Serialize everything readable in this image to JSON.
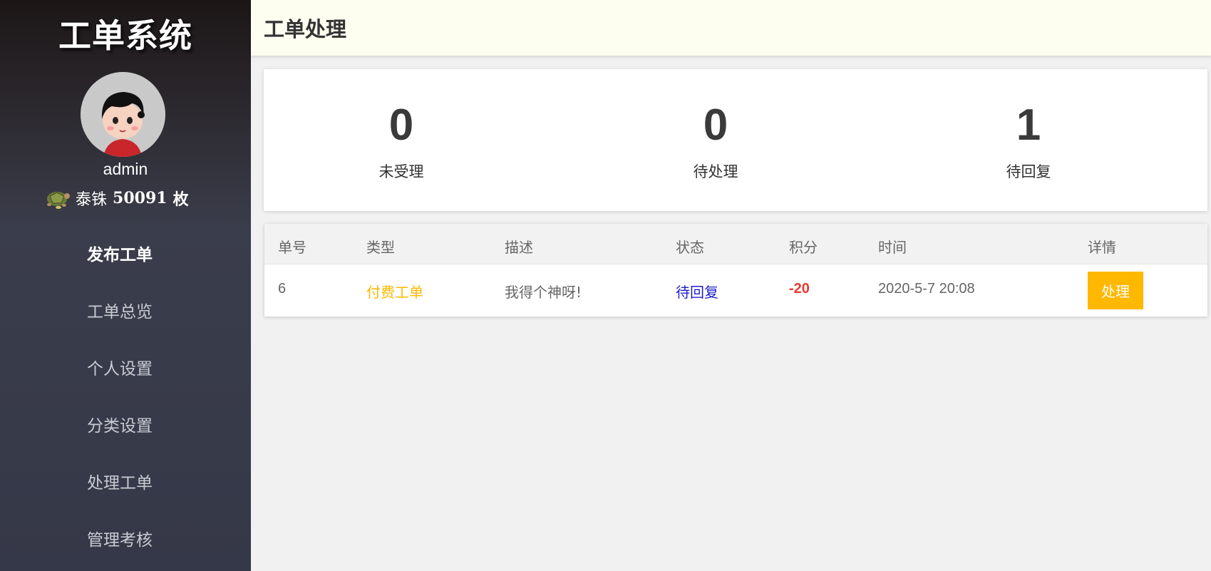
{
  "sidebar": {
    "brand": "工单系统",
    "username": "admin",
    "coins": {
      "label": "泰铢",
      "count": "50091",
      "unit": "枚"
    },
    "nav": [
      {
        "label": "发布工单",
        "active": true
      },
      {
        "label": "工单总览",
        "active": false
      },
      {
        "label": "个人设置",
        "active": false
      },
      {
        "label": "分类设置",
        "active": false
      },
      {
        "label": "处理工单",
        "active": false
      },
      {
        "label": "管理考核",
        "active": false
      }
    ]
  },
  "header": {
    "title": "工单处理"
  },
  "stats": [
    {
      "value": "0",
      "label": "未受理"
    },
    {
      "value": "0",
      "label": "待处理"
    },
    {
      "value": "1",
      "label": "待回复"
    }
  ],
  "table": {
    "columns": [
      "单号",
      "类型",
      "描述",
      "状态",
      "积分",
      "时间",
      "详情"
    ],
    "rows": [
      {
        "id": "6",
        "type": "付费工单",
        "description": "我得个神呀!",
        "status": "待回复",
        "points": "-20",
        "time": "2020-5-7 20:08",
        "action": "处理"
      }
    ]
  },
  "colors": {
    "accent": "#ffb800",
    "status_blue": "#1e1ec8",
    "points_red": "#e83a2e",
    "header_bg": "#fefef0"
  }
}
